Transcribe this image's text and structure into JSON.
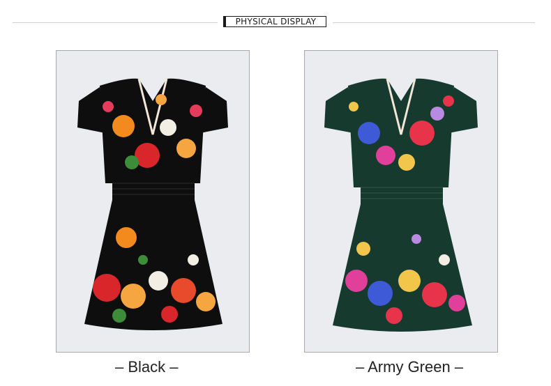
{
  "section_heading": "PHYSICAL DISPLAY",
  "products": [
    {
      "caption": "– Black –",
      "color_name": "Black",
      "dress_color": "#0e0e0e",
      "image_icon": "floral-dress-black"
    },
    {
      "caption": "– Army Green –",
      "color_name": "Army Green",
      "dress_color": "#163a2e",
      "image_icon": "floral-dress-army-green"
    }
  ]
}
